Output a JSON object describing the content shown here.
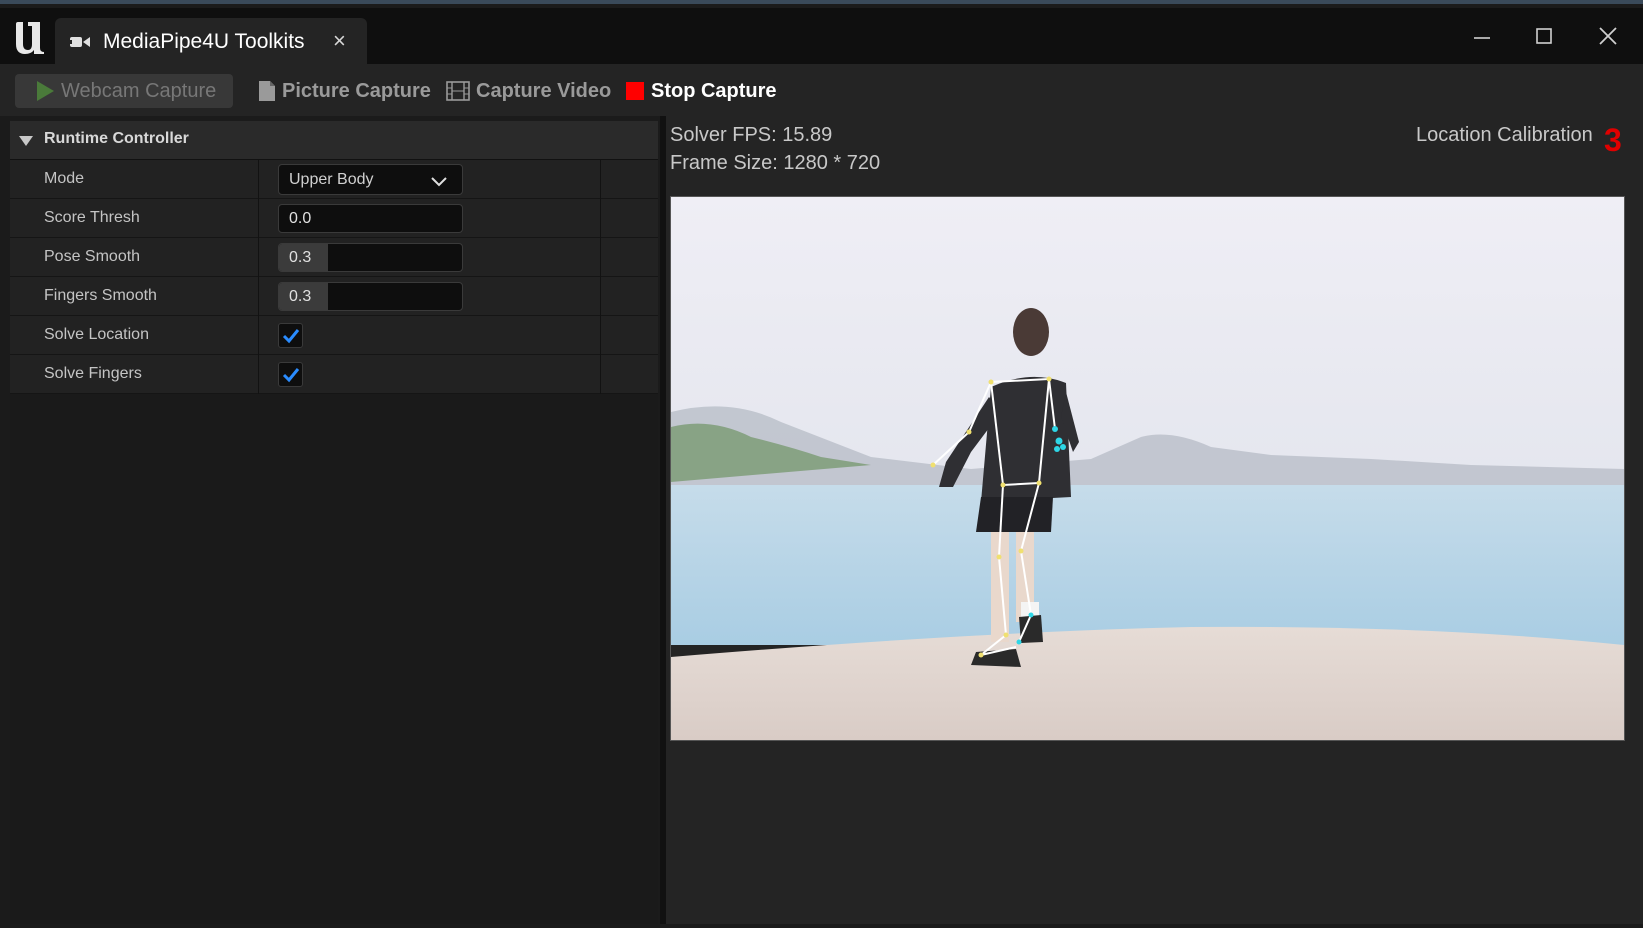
{
  "window": {
    "tab_title": "MediaPipe4U Toolkits",
    "tab_close": "×"
  },
  "toolbar": {
    "webcam_label": "Webcam Capture",
    "picture_label": "Picture Capture",
    "video_label": "Capture Video",
    "stop_label": "Stop Capture"
  },
  "runtime_controller": {
    "title": "Runtime Controller",
    "mode_label": "Mode",
    "mode_value": "Upper Body",
    "score_thresh_label": "Score Thresh",
    "score_thresh_value": "0.0",
    "pose_smooth_label": "Pose Smooth",
    "pose_smooth_value": "0.3",
    "fingers_smooth_label": "Fingers Smooth",
    "fingers_smooth_value": "0.3",
    "solve_location_label": "Solve Location",
    "solve_location_checked": true,
    "solve_fingers_label": "Solve Fingers",
    "solve_fingers_checked": true
  },
  "stats": {
    "solver_fps": "Solver FPS:  15.89",
    "frame_size": "Frame Size:  1280 * 720",
    "location_calibration_label": "Location Calibration",
    "location_calibration_count": "3"
  },
  "icons": {
    "app_logo": "unreal-logo",
    "tab_icon": "camera-icon",
    "webcam_icon": "play-icon",
    "picture_icon": "file-icon",
    "video_icon": "film-icon",
    "stop_icon": "stop-square-icon"
  },
  "colors": {
    "stop_red": "#ff0000",
    "calibration_red": "#e00000",
    "checkmark_blue": "#2a8cff",
    "webcam_play_green": "#4a7a3a"
  }
}
